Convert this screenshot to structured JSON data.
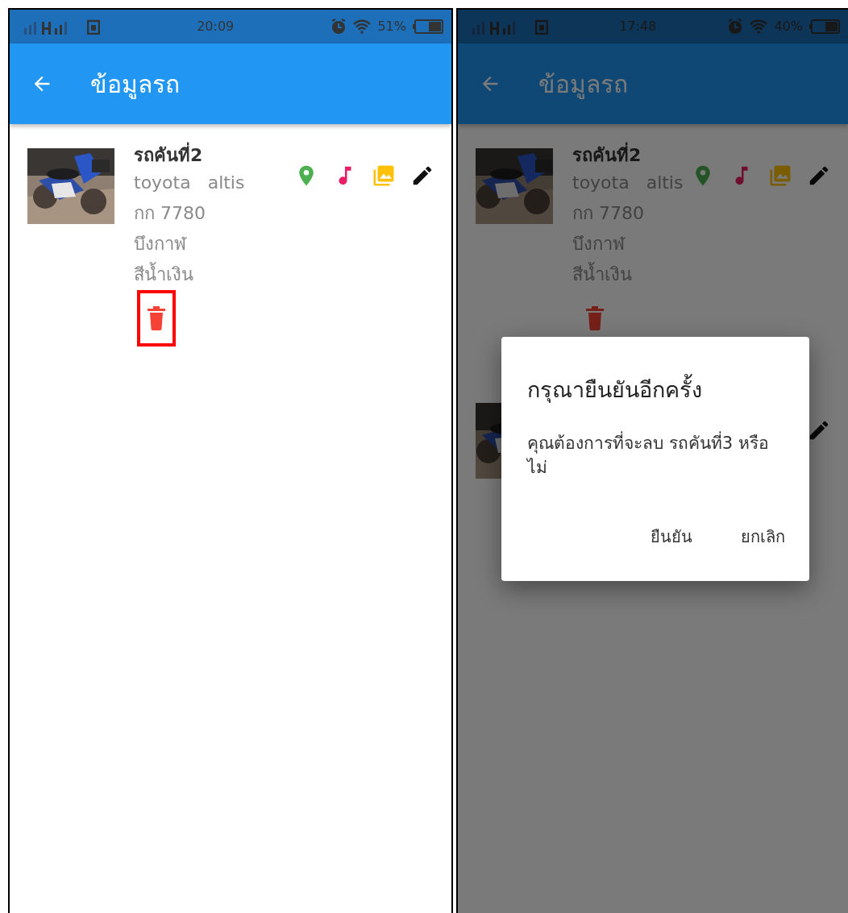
{
  "screens": [
    {
      "status_bar": {
        "time": "20:09",
        "battery": "51%"
      },
      "app_bar": {
        "title": "ข้อมูลรถ"
      },
      "cars": [
        {
          "name": "รถคันที่2",
          "model": "toyota   altis",
          "plate": "กก 7780",
          "province": "บึงกาฬ",
          "color_name": "สีน้ำเงิน",
          "picture": {
            "kind": "picture"
          },
          "delete_highlighted": true
        }
      ]
    },
    {
      "status_bar": {
        "time": "17:48",
        "battery": "40%"
      },
      "app_bar": {
        "title": "ข้อมูลรถ"
      },
      "cars": [
        {
          "name": "รถคันที่2",
          "model": "toyota   altis",
          "plate": "กก 7780",
          "province": "บึงกาฬ",
          "color_name": "สีน้ำเงิน",
          "picture": {
            "kind": "picture"
          },
          "delete_highlighted": false
        },
        {
          "picture": {
            "kind": "picture"
          }
        }
      ],
      "dialog": {
        "title": "กรุณายืนยันอีกครั้ง",
        "message": "คุณต้องการที่จะลบ  รถคันที่3 หรือไม่",
        "buttons": [
          "ยืนยัน",
          "ยกเลิก"
        ]
      }
    }
  ]
}
